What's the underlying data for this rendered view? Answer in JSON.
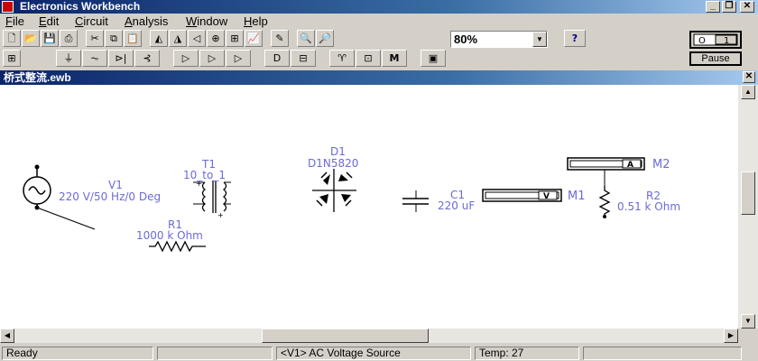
{
  "window": {
    "title": "Electronics Workbench"
  },
  "menu": {
    "items": [
      {
        "label": "File",
        "u": "F",
        "rest": "ile"
      },
      {
        "label": "Edit",
        "u": "E",
        "rest": "dit"
      },
      {
        "label": "Circuit",
        "u": "C",
        "rest": "ircuit"
      },
      {
        "label": "Analysis",
        "u": "A",
        "rest": "nalysis"
      },
      {
        "label": "Window",
        "u": "W",
        "rest": "indow"
      },
      {
        "label": "Help",
        "u": "H",
        "rest": "elp"
      }
    ]
  },
  "toolbar": {
    "zoom_value": "80%",
    "help_label": "?",
    "pause_label": "Pause",
    "power_label": "O 1"
  },
  "document": {
    "title": "桥式整流.ewb"
  },
  "circuit": {
    "v1_name": "V1",
    "v1_value": "220 V/50 Hz/0 Deg",
    "t1_name": "T1",
    "t1_value": "10_to_1",
    "r1_name": "R1",
    "r1_value": "1000 k Ohm",
    "d1_name": "D1",
    "d1_value": "D1N5820",
    "c1_name": "C1",
    "c1_value": "220 uF",
    "m1_name": "M1",
    "m1_mode": "V",
    "m2_name": "M2",
    "m2_mode": "A",
    "r2_name": "R2",
    "r2_value": "0.51 k Ohm"
  },
  "status": {
    "ready": "Ready",
    "component": "<V1> AC Voltage Source",
    "temp": "Temp:  27"
  }
}
